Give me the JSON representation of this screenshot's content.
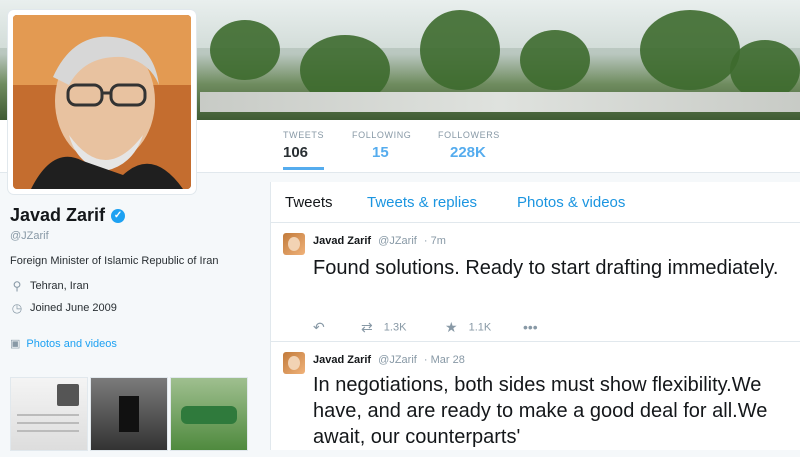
{
  "profile": {
    "name": "Javad Zarif",
    "handle": "@JZarif",
    "bio": "Foreign Minister of Islamic Republic of Iran",
    "location": "Tehran, Iran",
    "joined": "Joined June 2009",
    "photos_link": "Photos and videos"
  },
  "stats": [
    {
      "label": "TWEETS",
      "value": "106"
    },
    {
      "label": "FOLLOWING",
      "value": "15"
    },
    {
      "label": "FOLLOWERS",
      "value": "228K"
    }
  ],
  "tabs": [
    "Tweets",
    "Tweets & replies",
    "Photos & videos"
  ],
  "tweets": [
    {
      "name": "Javad Zarif",
      "handle": "@JZarif",
      "time": "· 7m",
      "text": "Found solutions. Ready to start drafting immediately.",
      "retweets": "1.3K",
      "likes": "1.1K"
    },
    {
      "name": "Javad Zarif",
      "handle": "@JZarif",
      "time": "· Mar 28",
      "text": "In negotiations, both sides must show flexibility.We have, and are ready to make a good deal for all.We await, our counterparts'"
    }
  ],
  "icons": {
    "location": "location-pin-icon",
    "calendar": "calendar-icon",
    "camera": "camera-icon",
    "verified": "verified-badge-icon",
    "reply": "reply-icon",
    "retweet": "retweet-icon",
    "like": "star-icon",
    "more": "more-icon"
  },
  "colors": {
    "accent": "#55acee",
    "link": "#1b95e0",
    "muted": "#8899a6"
  }
}
